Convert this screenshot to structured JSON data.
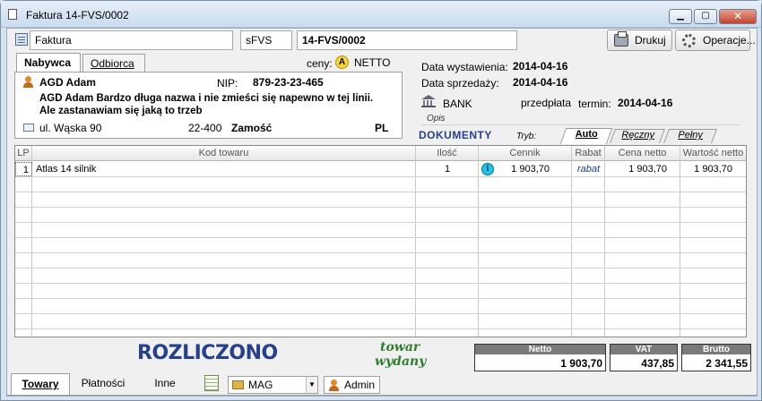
{
  "window": {
    "title": "Faktura 14-FVS/0002"
  },
  "toolbar": {
    "doc_type": "Faktura",
    "series": "sFVS",
    "number": "14-FVS/0002",
    "print_label": "Drukuj",
    "operations_label": "Operacje..."
  },
  "party_tabs": {
    "buyer": "Nabywca",
    "recipient": "Odbiorca"
  },
  "prices": {
    "label": "ceny:",
    "badge": "A",
    "mode": "NETTO"
  },
  "buyer": {
    "short_name": "AGD Adam",
    "nip_label": "NIP:",
    "nip": "879-23-23-465",
    "full_name_line1": "AGD Adam Bardzo długa nazwa i nie zmieści się napewno w tej linii.",
    "full_name_line2": "Ale zastanawiam się jaką to trzeb",
    "street": "ul. Wąska 90",
    "postal_code": "22-400",
    "city": "Zamość",
    "country": "PL"
  },
  "dates": {
    "issue_label": "Data wystawienia:",
    "issue_date": "2014-04-16",
    "sale_label": "Data sprzedaży:",
    "sale_date": "2014-04-16"
  },
  "payment": {
    "method": "BANK",
    "kind": "przedpłata",
    "term_label": "termin:",
    "term_date": "2014-04-16",
    "description_label": "Opis"
  },
  "documents": {
    "label": "DOKUMENTY",
    "mode_label": "Tryb:",
    "tabs": [
      "Auto",
      "Ręczny",
      "Pełny"
    ]
  },
  "table": {
    "headers": [
      "LP",
      "Kod towaru",
      "Ilość",
      "Cennik",
      "Rabat",
      "Cena netto",
      "Wartość netto"
    ],
    "rows": [
      {
        "lp": "1",
        "code": "Atlas 14 silnik",
        "qty": "1",
        "price_list": "1 903,70",
        "discount": "rabat",
        "net_price": "1 903,70",
        "net_value": "1 903,70"
      }
    ]
  },
  "status": {
    "settled": "ROZLICZONO",
    "goods_line1": "towar",
    "goods_line2": "wydany"
  },
  "totals": {
    "net_label": "Netto",
    "net": "1 903,70",
    "vat_label": "VAT",
    "vat": "437,85",
    "gross_label": "Brutto",
    "gross": "2 341,55"
  },
  "bottom": {
    "tabs": [
      "Towary",
      "Płatności",
      "Inne"
    ],
    "warehouse": "MAG",
    "user": "Admin"
  },
  "colors": {
    "settled": "#24408e",
    "goods_issued": "#2e7d2e",
    "info_icon": "#19c8ea"
  }
}
